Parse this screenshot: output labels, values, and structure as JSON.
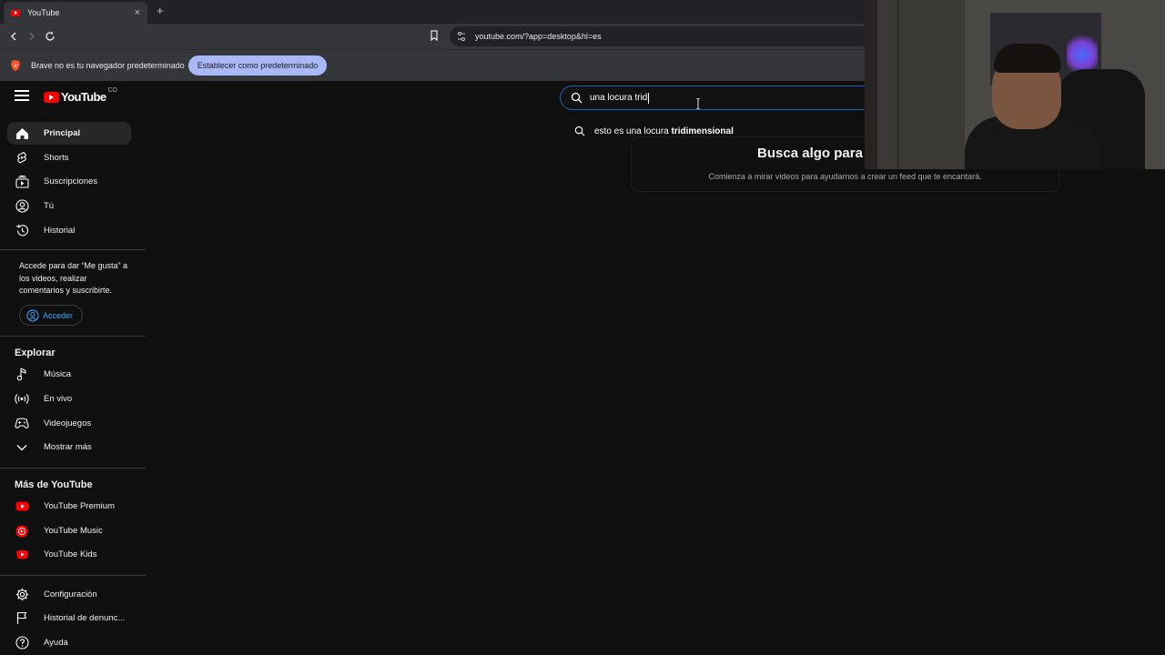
{
  "browser": {
    "tab_title": "YouTube",
    "tab_close": "×",
    "new_tab": "+",
    "url": "youtube.com/?app=desktop&hl=es",
    "infobar_text": "Brave no es tu navegador predeterminado",
    "default_button": "Establecer como predeterminado"
  },
  "youtube": {
    "logo_text": "YouTube",
    "logo_sup": "CO",
    "search_value": "una locura trid",
    "suggestion_prefix": "esto es una locura ",
    "suggestion_bold": "tridimensional",
    "feed_title": "Busca algo para",
    "feed_subtitle": "Comienza a mirar videos para ayudarnos a crear un feed que te encantará."
  },
  "sidebar": {
    "main_items": [
      {
        "label": "Principal",
        "icon": "home-icon"
      },
      {
        "label": "Shorts",
        "icon": "shorts-icon"
      },
      {
        "label": "Suscripciones",
        "icon": "subscriptions-icon"
      },
      {
        "label": "Tú",
        "icon": "you-icon"
      },
      {
        "label": "Historial",
        "icon": "history-icon"
      }
    ],
    "login_text": "Accede para dar “Me gusta” a los videos, realizar comentarios y suscribirte.",
    "login_button": "Acceder",
    "explore_heading": "Explorar",
    "explore_items": [
      {
        "label": "Música",
        "icon": "music-icon"
      },
      {
        "label": "En vivo",
        "icon": "live-icon"
      },
      {
        "label": "Videojuegos",
        "icon": "gaming-icon"
      },
      {
        "label": "Mostrar más",
        "icon": "chevron-down-icon"
      }
    ],
    "more_heading": "Más de YouTube",
    "more_items": [
      {
        "label": "YouTube Premium",
        "icon": "youtube-premium-icon"
      },
      {
        "label": "YouTube Music",
        "icon": "youtube-music-icon"
      },
      {
        "label": "YouTube Kids",
        "icon": "youtube-kids-icon"
      }
    ],
    "footer_items": [
      {
        "label": "Configuración",
        "icon": "settings-icon"
      },
      {
        "label": "Historial de denunc...",
        "icon": "flag-icon"
      },
      {
        "label": "Ayuda",
        "icon": "help-icon"
      }
    ]
  },
  "colors": {
    "background": "#0f0f0f",
    "accent_red": "#ff0000",
    "link_blue": "#3ea6ff",
    "default_button_bg": "#a8b8f8"
  }
}
